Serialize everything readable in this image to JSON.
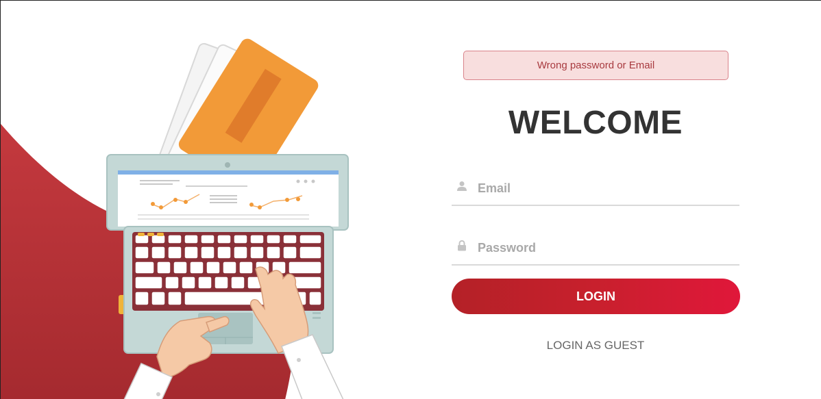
{
  "alert": {
    "message": "Wrong password or Email"
  },
  "title": "WELCOME",
  "form": {
    "email_placeholder": "Email",
    "email_value": "",
    "password_placeholder": "Password",
    "password_value": ""
  },
  "buttons": {
    "login_label": "LOGIN",
    "guest_label": "LOGIN AS GUEST"
  },
  "icons": {
    "email": "user-icon",
    "password": "lock-icon"
  },
  "colors": {
    "accent_start": "#b42127",
    "accent_end": "#e0173a",
    "alert_bg": "#f8dede",
    "alert_text": "#a83a3f",
    "title_text": "#333333",
    "laptop_body": "#c4d8d6",
    "folder_orange": "#f29a38"
  }
}
